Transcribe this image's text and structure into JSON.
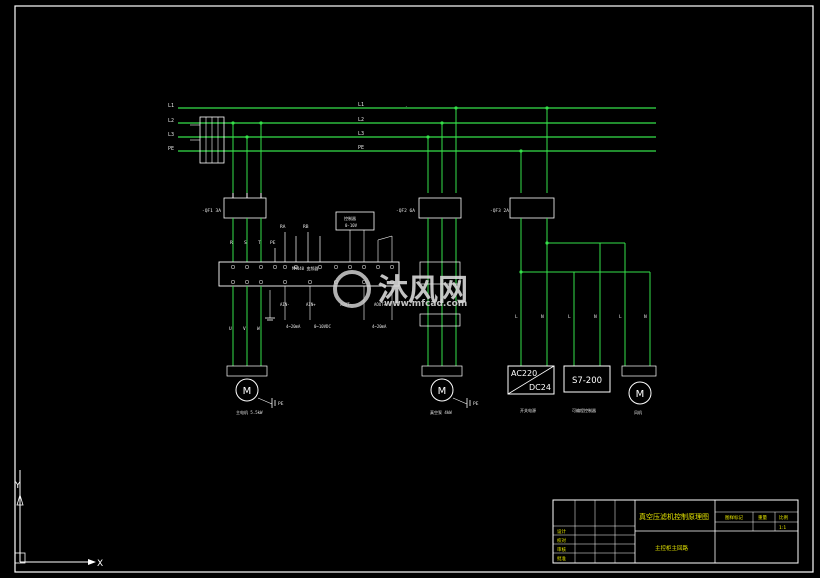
{
  "drawing": {
    "title": "真空压滤机控制原理图",
    "subtitle": "主控柜主回路"
  },
  "bus_labels": [
    "L1",
    "L2",
    "L3",
    "PE"
  ],
  "left_branch": {
    "breaker": "-QF1 3A",
    "terminals_top": [
      "R",
      "S",
      "T",
      "PE",
      "RA",
      "RB"
    ],
    "inverter_label": "MM440 变频器",
    "terminals_bottom": [
      "AIN-",
      "AIN+",
      "AOUT-",
      "AOUT+"
    ],
    "signal_labels": [
      "4~20mA",
      "0~10VDC",
      "4~20mA"
    ],
    "motor_terminals": [
      "U",
      "V",
      "W"
    ],
    "motor_symbol": "M",
    "motor_caption": "主电机 5.5kW",
    "pe_label": "PE"
  },
  "plc_box": {
    "label": "控制器",
    "sub": "0-10V"
  },
  "middle_branch": {
    "breaker": "-QF2 6A",
    "motor_symbol": "M",
    "motor_caption": "真空泵 4kW",
    "pe_label": "PE"
  },
  "right_branch": {
    "breaker": "-QF3 2A",
    "wire_labels": [
      "L",
      "N",
      "L",
      "N",
      "L",
      "N"
    ],
    "psu": {
      "top": "AC220",
      "bottom": "DC24",
      "caption": "开关电源"
    },
    "plc": {
      "label": "S7-200",
      "caption": "可编程控制器"
    },
    "fan": {
      "symbol": "M",
      "caption": "风机"
    }
  },
  "title_block": {
    "left_headers": [
      "设计",
      "校对",
      "审核",
      "批准"
    ],
    "right_headers": [
      "图样标记",
      "重量",
      "比例"
    ],
    "right_values": [
      "",
      "",
      "1:1"
    ]
  },
  "watermark": {
    "text": "沐风网",
    "url": "www.mfcad.com"
  },
  "ucs": {
    "x": "X",
    "y": "Y"
  }
}
